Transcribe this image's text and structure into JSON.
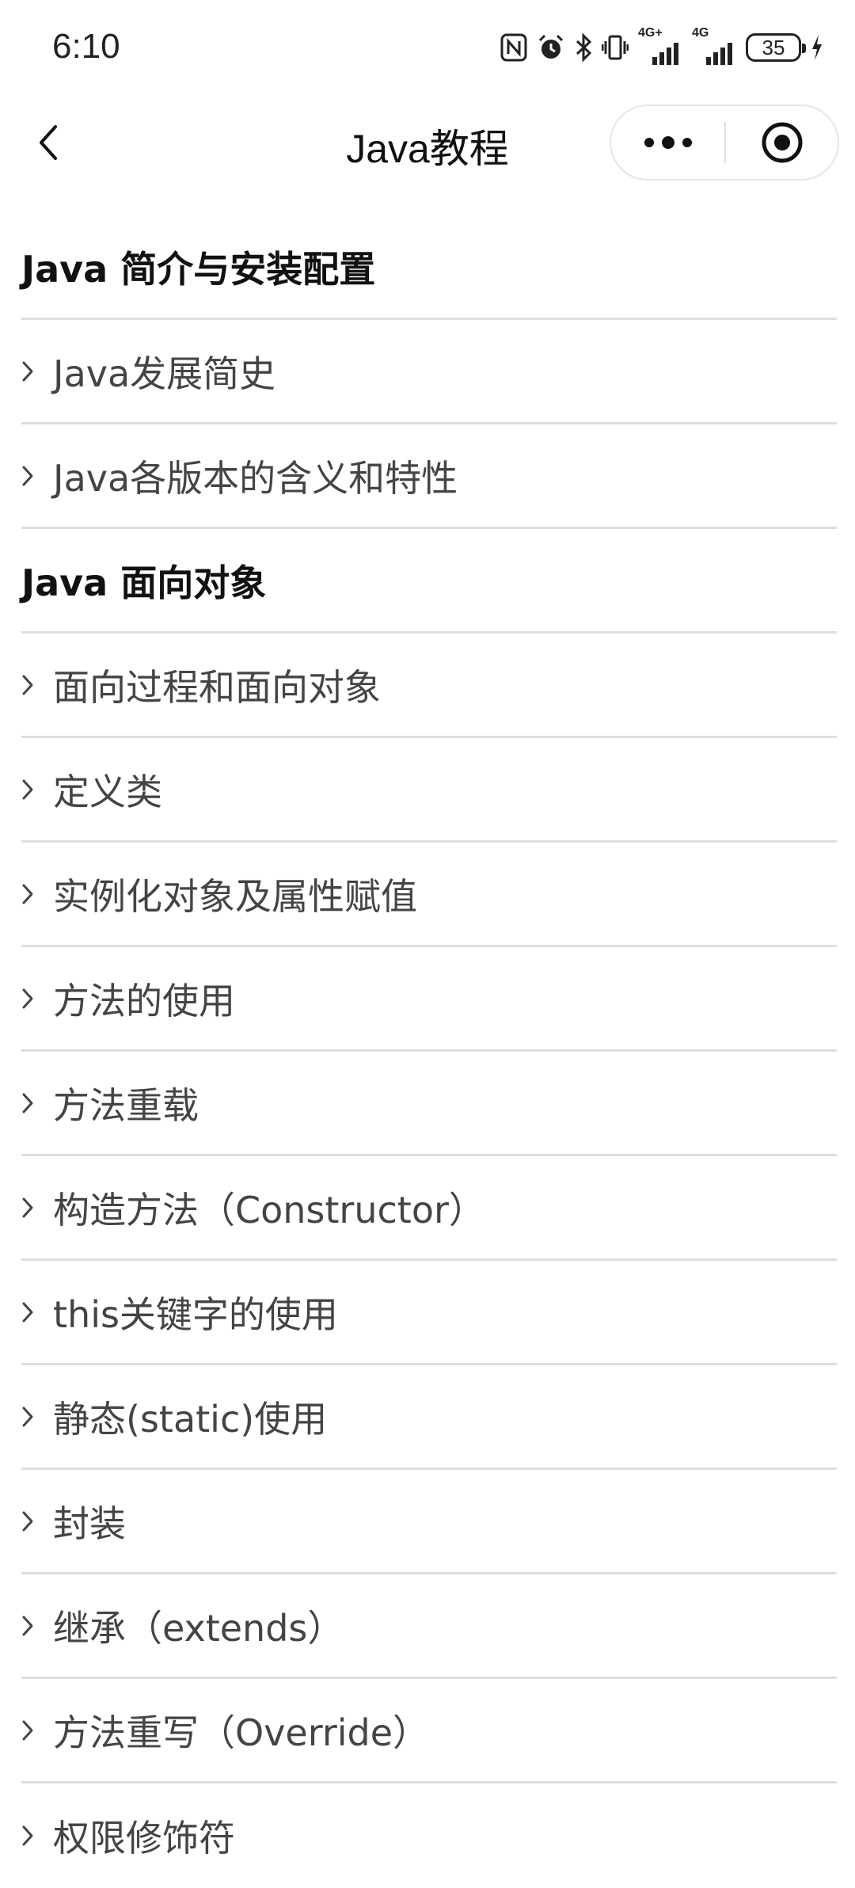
{
  "status_bar": {
    "time": "6:10",
    "battery": "35",
    "network_1": "4G+",
    "network_2": "4G"
  },
  "nav": {
    "title": "Java教程"
  },
  "sections": [
    {
      "title": "Java 简介与安装配置",
      "items": [
        "Java发展简史",
        "Java各版本的含义和特性"
      ]
    },
    {
      "title": "Java 面向对象",
      "items": [
        "面向过程和面向对象",
        "定义类",
        "实例化对象及属性赋值",
        "方法的使用",
        "方法重载",
        "构造方法（Constructor）",
        "this关键字的使用",
        "静态(static)使用",
        "封装",
        "继承（extends）",
        "方法重写（Override）",
        "权限修饰符"
      ]
    }
  ],
  "colors": {
    "divider": "#dedede",
    "item_text": "#444444",
    "header_text": "#111111"
  }
}
